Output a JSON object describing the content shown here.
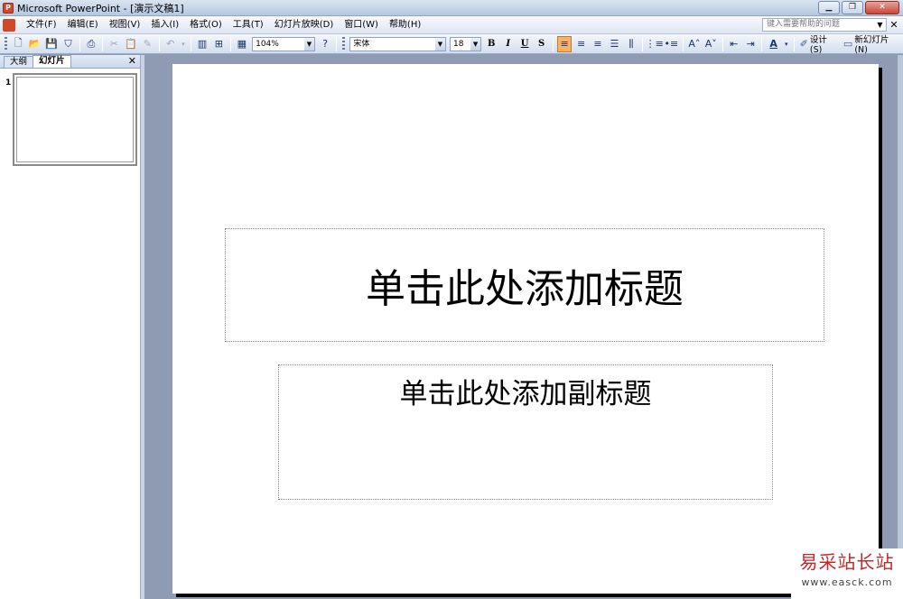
{
  "window": {
    "title": "Microsoft PowerPoint - [演示文稿1]"
  },
  "menu": {
    "items": [
      "文件(F)",
      "编辑(E)",
      "视图(V)",
      "插入(I)",
      "格式(O)",
      "工具(T)",
      "幻灯片放映(D)",
      "窗口(W)",
      "帮助(H)"
    ],
    "help_placeholder": "键入需要帮助的问题"
  },
  "toolbar": {
    "zoom": "104%",
    "font": "宋体",
    "font_size": "18",
    "bold_label": "B",
    "italic_label": "I",
    "underline_label": "U",
    "shadow_label": "S",
    "design_label": "设计(S)",
    "new_slide_label": "新幻灯片(N)"
  },
  "left_pane": {
    "tabs": [
      "大纲",
      "幻灯片"
    ],
    "active_tab": "幻灯片",
    "slides": [
      {
        "number": "1"
      }
    ]
  },
  "slide": {
    "title_placeholder": "单击此处添加标题",
    "subtitle_placeholder": "单击此处添加副标题"
  },
  "watermark": {
    "cn": "易采站长站",
    "en": "www.easck.com"
  },
  "colors": {
    "accent": "#f7b266",
    "watermark": "#c0282d"
  }
}
